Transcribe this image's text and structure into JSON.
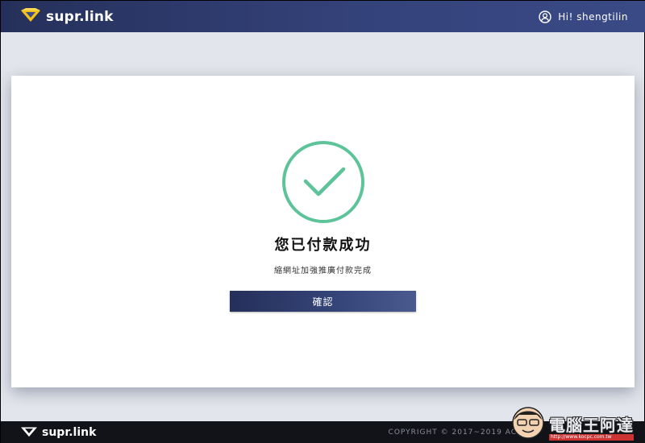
{
  "header": {
    "brand_name": "supr.link",
    "user_greeting": "Hi! shengtilin"
  },
  "main": {
    "title": "您已付款成功",
    "subtitle": "縮網址加強推廣付款完成",
    "confirm_label": "確認"
  },
  "footer": {
    "brand_name": "supr.link",
    "copyright": "COPYRIGHT © 2017~2019 AC"
  },
  "watermark": {
    "text": "電腦王阿達",
    "url": "http://www.kocpc.com.tw"
  },
  "colors": {
    "header_bg": "#2c3868",
    "accent_green": "#5dc49a",
    "button_bg": "#2f3c6c",
    "page_bg": "#e3e5ec",
    "footer_bg": "#111318"
  },
  "icons": {
    "logo": "diamond-logo-icon",
    "user": "user-circle-icon",
    "success": "check-circle-icon"
  }
}
